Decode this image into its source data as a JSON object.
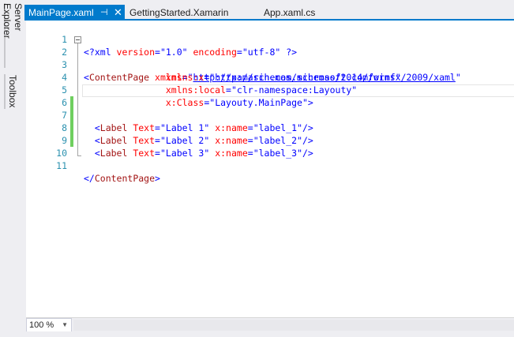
{
  "sidebar": {
    "server_explorer": "Server Explorer",
    "toolbox": "Toolbox"
  },
  "tabs": {
    "active": {
      "label": "MainPage.xaml",
      "pin": "⊣",
      "close": "✕"
    },
    "t2": "GettingStarted.Xamarin",
    "t3": "App.xaml.cs"
  },
  "editor": {
    "line_numbers": [
      "1",
      "2",
      "3",
      "4",
      "5",
      "6",
      "7",
      "8",
      "9",
      "10",
      "11"
    ],
    "l1": {
      "pi_open": "<?xml ",
      "a1": "version",
      "eq1": "=",
      "v1": "\"1.0\"",
      "a2": " encoding",
      "eq2": "=",
      "v2": "\"utf-8\"",
      "pi_close": " ?>"
    },
    "l2": {
      "open": "<",
      "tag": "ContentPage",
      "attr": " xmlns",
      "eq": "=",
      "q1": "\"",
      "link": "http://xamarin.com/schemas/2014/forms",
      "q2": "\""
    },
    "l3": {
      "indent": "               ",
      "attr": "xmlns:x",
      "eq": "=",
      "q1": "\"",
      "link": "http://schemas.microsoft.com/winfx/2009/xaml",
      "q2": "\""
    },
    "l4": {
      "indent": "               ",
      "attr": "xmlns:local",
      "eq": "=",
      "val": "\"clr-namespace:Layouty\""
    },
    "l5": {
      "indent": "               ",
      "attr": "x:Class",
      "eq": "=",
      "val": "\"Layouty.MainPage\"",
      "close": ">"
    },
    "labels": [
      {
        "open": "  <",
        "tag": "Label",
        "a1": " Text",
        "eq1": "=",
        "v1": "\"Label 1\"",
        "a2": " x:name",
        "eq2": "=",
        "v2": "\"label_1\"",
        "close": "/>"
      },
      {
        "open": "  <",
        "tag": "Label",
        "a1": " Text",
        "eq1": "=",
        "v1": "\"Label 2\"",
        "a2": " x:name",
        "eq2": "=",
        "v2": "\"label_2\"",
        "close": "/>"
      },
      {
        "open": "  <",
        "tag": "Label",
        "a1": " Text",
        "eq1": "=",
        "v1": "\"Label 3\"",
        "a2": " x:name",
        "eq2": "=",
        "v2": "\"label_3\"",
        "close": "/>"
      }
    ],
    "l11": {
      "open": "</",
      "tag": "ContentPage",
      "close": ">"
    }
  },
  "zoom": {
    "value": "100 %",
    "arrow": "▼"
  },
  "colors": {
    "accent": "#007acc",
    "change_bar": "#6fcf5f",
    "line_number": "#2b91af"
  },
  "icons": {
    "pin": "pin-icon",
    "close": "close-icon",
    "fold": "collapse-icon",
    "dropdown": "chevron-down-icon"
  }
}
